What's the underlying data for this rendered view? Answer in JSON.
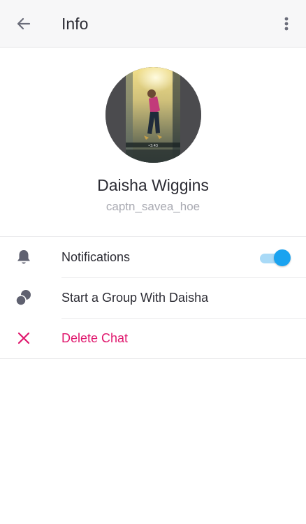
{
  "header": {
    "title": "Info",
    "back_icon": "arrow-left-icon",
    "more_icon": "more-vertical-icon"
  },
  "profile": {
    "name": "Daisha Wiggins",
    "username": "captn_savea_hoe",
    "avatar_caption": "•3:43"
  },
  "rows": [
    {
      "icon": "bell-icon",
      "label": "Notifications",
      "toggle_on": true
    },
    {
      "icon": "group-icon",
      "label": "Start a Group With Daisha"
    },
    {
      "icon": "close-icon",
      "label": "Delete Chat",
      "danger": true
    }
  ],
  "colors": {
    "accent": "#1aa3f0",
    "danger": "#e0176d",
    "text_primary": "#2b2b33",
    "text_secondary": "#a9aab2",
    "icon_gray": "#5f6170"
  }
}
